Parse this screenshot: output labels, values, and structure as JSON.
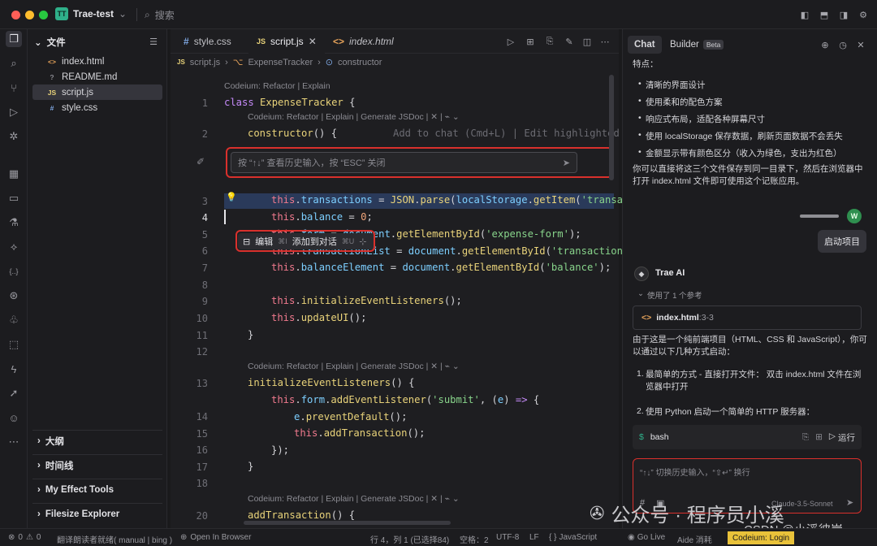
{
  "titlebar": {
    "badge": "TT",
    "project": "Trae-test",
    "search_placeholder": "搜索"
  },
  "colors": {
    "accent_green": "#2fb08a",
    "highlight_red": "#d9302c",
    "keyword": "#c58af9",
    "string": "#88d48b",
    "prop": "#7dcfff"
  },
  "sidebar": {
    "title": "文件",
    "files": [
      {
        "icon": "<>",
        "name": "index.html",
        "icon_color": "#e7a35a"
      },
      {
        "icon": "?",
        "name": "README.md",
        "icon_color": "#8b8b92"
      },
      {
        "icon": "JS",
        "name": "script.js",
        "icon_color": "#e9d37a"
      },
      {
        "icon": "#",
        "name": "style.css",
        "icon_color": "#7da6e0"
      }
    ],
    "sections": [
      "大纲",
      "时间线",
      "My Effect Tools",
      "Filesize Explorer"
    ]
  },
  "editor": {
    "tabs": [
      {
        "icon": "#",
        "label": "style.css"
      },
      {
        "icon": "JS",
        "label": "script.js"
      },
      {
        "icon": "<>",
        "label": "index.html"
      }
    ],
    "breadcrumb": [
      "script.js",
      "ExpenseTracker",
      "constructor"
    ],
    "lens1": "Codeium: Refactor | Explain",
    "lens2": "Codeium: Refactor | Explain | Generate JSDoc | ✕ | ⌁ ⌄",
    "ghost": "Add to chat (Cmd+L) | Edit highlighted",
    "inline_placeholder": "按 “↑↓” 查看历史输入，按 “ESC” 关闭",
    "action_edit": "编辑",
    "action_edit_kbd": "⌘I",
    "action_add": "添加到对话",
    "action_add_kbd": "⌘U",
    "line_numbers": [
      "1",
      "2",
      "3",
      "4",
      "5",
      "6",
      "7",
      "8",
      "9",
      "10",
      "11",
      "12",
      "13",
      "14",
      "15",
      "16",
      "17",
      "18",
      "19",
      "20"
    ]
  },
  "chat": {
    "tab_chat": "Chat",
    "tab_builder": "Builder",
    "beta": "Beta",
    "features_title": "特点：",
    "features": [
      "清晰的界面设计",
      "使用柔和的配色方案",
      "响应式布局，适配各种屏幕尺寸",
      "使用 localStorage 保存数据，刷新页面数据不会丢失",
      "金额显示带有颜色区分（收入为绿色，支出为红色）"
    ],
    "para1": "你可以直接将这三个文件保存到同一目录下，然后在浏览器中打开 index.html 文件即可使用这个记账应用。",
    "user_avatar": "W",
    "user_msg": "启动项目",
    "ai_name": "Trae AI",
    "refs": "使用了 1 个参考",
    "ref_file": "index.html",
    "ref_range": ":3-3",
    "para2": "由于这是一个纯前端项目（HTML、CSS 和 JavaScript），你可以通过以下几种方式启动：",
    "step1": "最简单的方式 - 直接打开文件： 双击 index.html 文件在浏览器中打开",
    "step2": "使用 Python 启动一个简单的 HTTP 服务器：",
    "code_lang": "bash",
    "run_label": "运行",
    "input_placeholder": "“↑↓” 切换历史输入，“⇧↵” 换行",
    "model": "Claude-3.5-Sonnet"
  },
  "status": {
    "errors": "0",
    "warnings": "0",
    "reader": "翻译朗读者就绪( manual | bing )",
    "open_browser": "Open In Browser",
    "position": "行 4，列 1 (已选择84)",
    "spaces": "空格：2",
    "encoding": "UTF-8",
    "eol": "LF",
    "lang": "JavaScript",
    "golive": "Go Live",
    "aide": "Aide 消耗",
    "codeium": "Codeium: Login"
  },
  "watermark": {
    "line1": "公众号 · 程序员小溪",
    "line2": "CSDN @小溪彼岸"
  }
}
